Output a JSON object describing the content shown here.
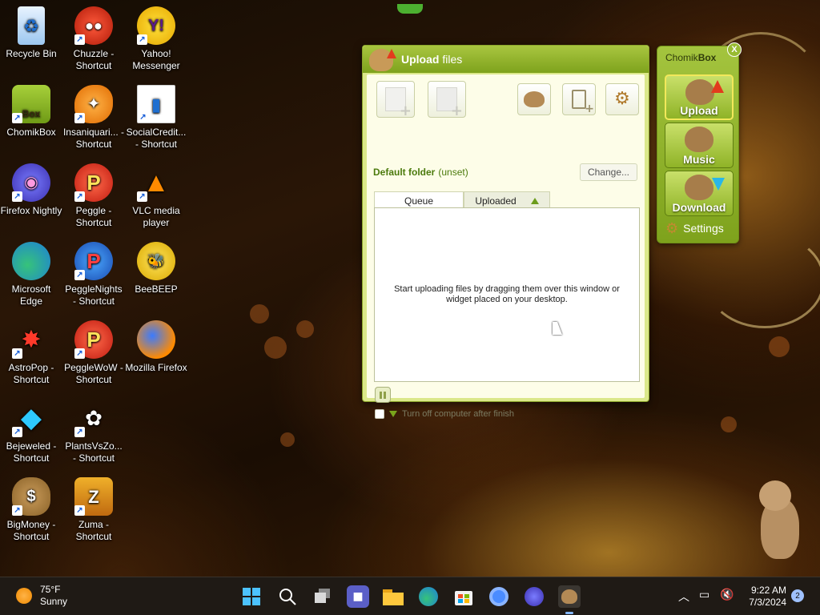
{
  "desktop": {
    "icons": [
      {
        "label": "Recycle Bin",
        "icon": "recycle-bin-icon"
      },
      {
        "label": "Chuzzle - Shortcut",
        "icon": "chuzzle-icon"
      },
      {
        "label": "Yahoo! Messenger",
        "icon": "yahoo-messenger-icon"
      },
      {
        "label": "ChomikBox",
        "icon": "chomikbox-icon"
      },
      {
        "label": "Insaniquari... - Shortcut",
        "icon": "insaniquarium-icon"
      },
      {
        "label": "SocialCredit... - Shortcut",
        "icon": "socialcredit-icon"
      },
      {
        "label": "Firefox Nightly",
        "icon": "firefox-nightly-icon"
      },
      {
        "label": "Peggle - Shortcut",
        "icon": "peggle-icon"
      },
      {
        "label": "VLC media player",
        "icon": "vlc-icon"
      },
      {
        "label": "Microsoft Edge",
        "icon": "edge-icon"
      },
      {
        "label": "PeggleNights - Shortcut",
        "icon": "peggle-nights-icon"
      },
      {
        "label": "BeeBEEP",
        "icon": "beebeep-icon"
      },
      {
        "label": "AstroPop - Shortcut",
        "icon": "astropop-icon"
      },
      {
        "label": "PeggleWoW - Shortcut",
        "icon": "peggle-wow-icon"
      },
      {
        "label": "Mozilla Firefox",
        "icon": "firefox-icon"
      },
      {
        "label": "Bejeweled - Shortcut",
        "icon": "bejeweled-icon"
      },
      {
        "label": "PlantsVsZo... - Shortcut",
        "icon": "plants-vs-zombies-icon"
      },
      {
        "label": "BigMoney - Shortcut",
        "icon": "bigmoney-icon"
      },
      {
        "label": "Zuma - Shortcut",
        "icon": "zuma-icon"
      }
    ]
  },
  "upload_window": {
    "title_bold": "Upload",
    "title_rest": " files",
    "default_folder_label": "Default folder",
    "default_folder_value": "(unset)",
    "change_button": "Change...",
    "tabs": [
      {
        "label": "Queue",
        "active": true
      },
      {
        "label": "Uploaded",
        "active": false
      }
    ],
    "empty_message": "Start uploading files by dragging them over this window or widget placed on your desktop.",
    "turn_off_label": "Turn off computer after finish",
    "turn_off_checked": false
  },
  "widget": {
    "title_prefix": "Chomik",
    "title_bold": "Box",
    "close_label": "X",
    "buttons": [
      {
        "label": "Upload",
        "active": true
      },
      {
        "label": "Music",
        "active": false
      },
      {
        "label": "Download",
        "active": false
      }
    ],
    "settings_label": "Settings"
  },
  "taskbar": {
    "temperature": "75°F",
    "condition": "Sunny",
    "time": "9:22 AM",
    "date": "7/3/2024",
    "notifications": "2"
  }
}
